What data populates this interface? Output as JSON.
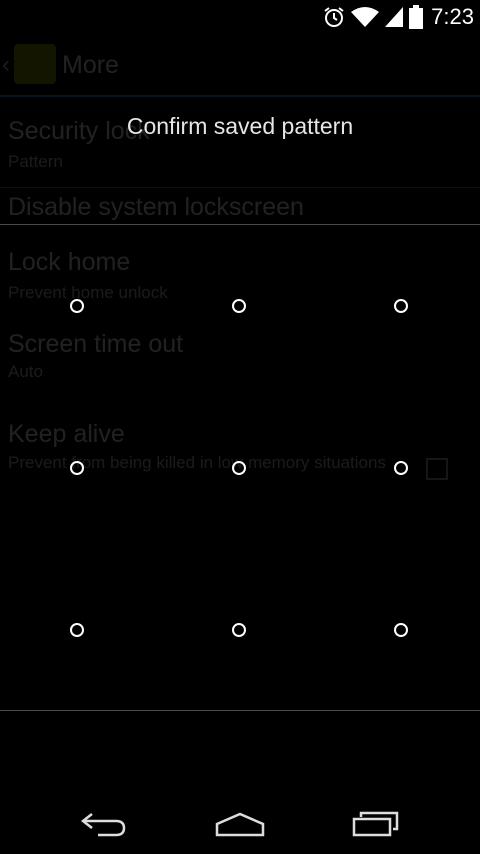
{
  "status_bar": {
    "time": "7:23",
    "icons": [
      "alarm-icon",
      "wifi-icon",
      "signal-icon",
      "battery-icon"
    ]
  },
  "background_screen": {
    "title": "More",
    "settings": [
      {
        "title": "Security lock",
        "summary": "Pattern"
      },
      {
        "title": "Disable system lockscreen",
        "summary": ""
      },
      {
        "title": "Lock home",
        "summary": "Prevent home unlock"
      },
      {
        "title": "Screen time out",
        "summary": "Auto"
      },
      {
        "title": "Keep alive",
        "summary": "Prevent from being killed in low memory situations"
      }
    ]
  },
  "dialog": {
    "title": "Confirm saved pattern"
  },
  "navigation": {
    "icons": [
      "back-icon",
      "home-icon",
      "recent-apps-icon"
    ]
  }
}
